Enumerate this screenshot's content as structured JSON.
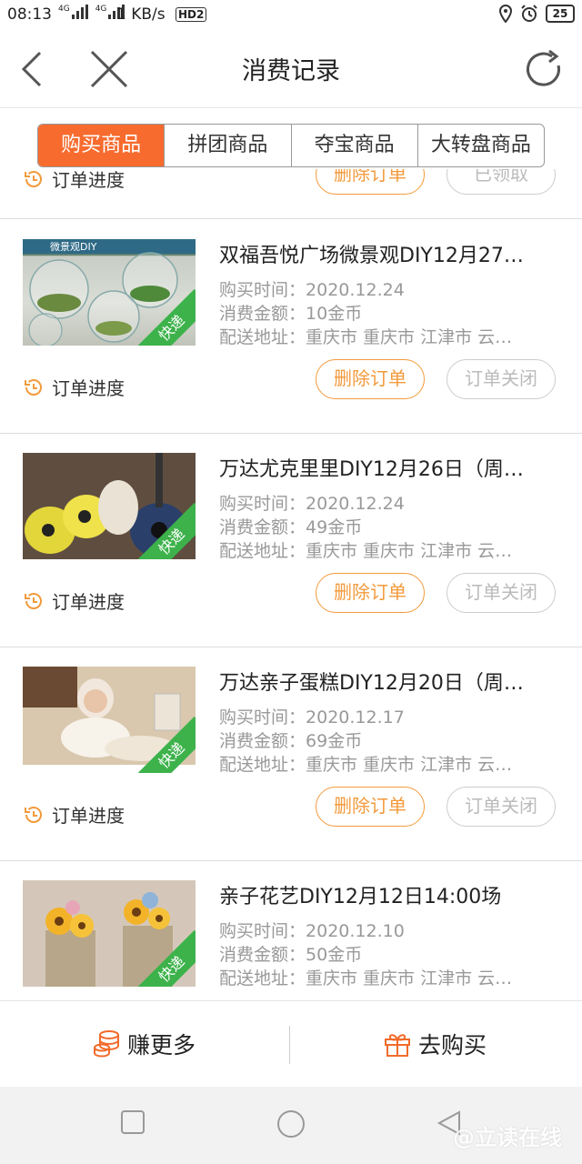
{
  "status_bar": {
    "time": "08:13",
    "net_speed": "1 KB/s",
    "hd": "HD2",
    "signal1": "4G",
    "signal2": "4G",
    "battery": "25"
  },
  "header": {
    "title": "消费记录"
  },
  "tabs": [
    {
      "label": "购买商品",
      "active": true
    },
    {
      "label": "拼团商品",
      "active": false
    },
    {
      "label": "夺宝商品",
      "active": false
    },
    {
      "label": "大转盘商品",
      "active": false
    }
  ],
  "partial_row": {
    "progress_label": "订单进度",
    "delete_label": "删除订单",
    "status_label": "已领取"
  },
  "labels": {
    "purchase_time": "购买时间：",
    "amount": "消费金额：",
    "address": "配送地址：",
    "progress": "订单进度",
    "delete": "删除订单",
    "closed": "订单关闭",
    "badge": "快递"
  },
  "orders": [
    {
      "title": "双福吾悦广场微景观DIY12月27…",
      "time": "2020.12.24",
      "amount": "10金币",
      "address": "重庆市 重庆市 江津市 云…",
      "image_text": "微景观DIY"
    },
    {
      "title": "万达尤克里里DIY12月26日（周…",
      "time": "2020.12.24",
      "amount": "49金币",
      "address": "重庆市 重庆市 江津市 云…"
    },
    {
      "title": "万达亲子蛋糕DIY12月20日（周…",
      "time": "2020.12.17",
      "amount": "69金币",
      "address": "重庆市 重庆市 江津市 云…"
    },
    {
      "title": "亲子花艺DIY12月12日14:00场",
      "time": "2020.12.10",
      "amount": "50金币",
      "address": "重庆市 重庆市 江津市 云…"
    }
  ],
  "bottom_bar": {
    "earn_label": "赚更多",
    "buy_label": "去购买"
  },
  "watermark": "@立读在线",
  "colors": {
    "accent": "#f76b2e",
    "button_orange": "#f39a3c",
    "badge_green": "#3db24b"
  }
}
